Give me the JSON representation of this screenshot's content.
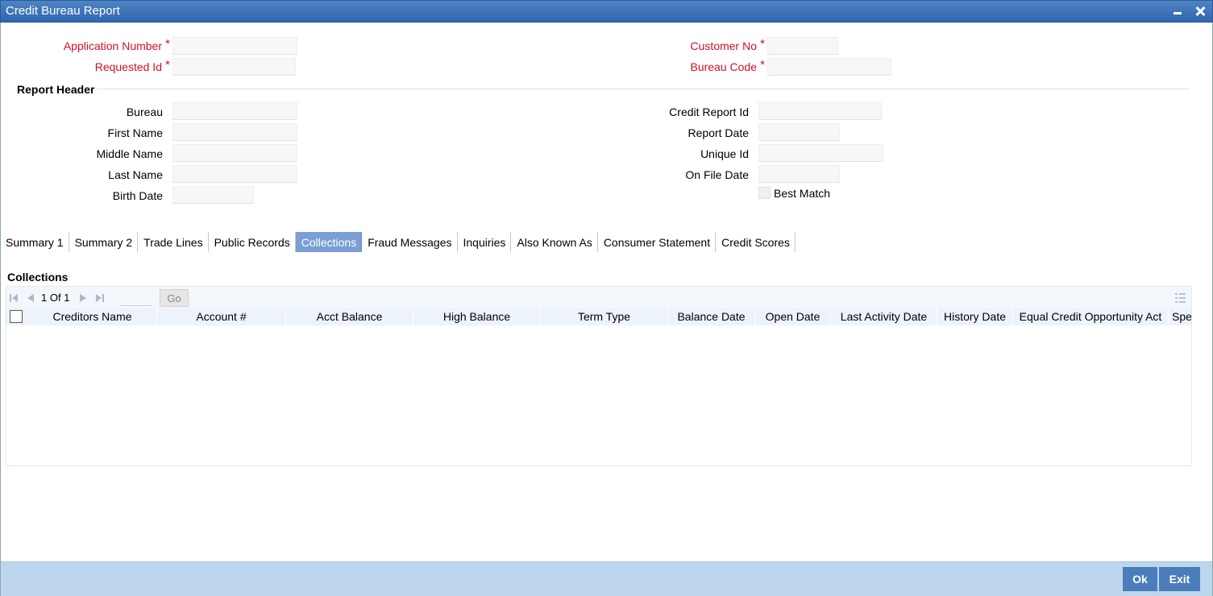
{
  "window": {
    "title": "Credit Bureau Report"
  },
  "top_fields": {
    "application_number": {
      "label": "Application Number",
      "value": ""
    },
    "requested_id": {
      "label": "Requested Id",
      "value": ""
    },
    "customer_no": {
      "label": "Customer No",
      "value": ""
    },
    "bureau_code": {
      "label": "Bureau Code",
      "value": ""
    },
    "required_mark": "*"
  },
  "report_header": {
    "title": "Report Header",
    "bureau": {
      "label": "Bureau",
      "value": ""
    },
    "first_name": {
      "label": "First Name",
      "value": ""
    },
    "middle_name": {
      "label": "Middle Name",
      "value": ""
    },
    "last_name": {
      "label": "Last Name",
      "value": ""
    },
    "birth_date": {
      "label": "Birth Date",
      "value": ""
    },
    "credit_report_id": {
      "label": "Credit Report Id",
      "value": ""
    },
    "report_date": {
      "label": "Report Date",
      "value": ""
    },
    "unique_id": {
      "label": "Unique Id",
      "value": ""
    },
    "on_file_date": {
      "label": "On File Date",
      "value": ""
    },
    "best_match": {
      "label": "Best Match",
      "checked": false
    }
  },
  "tabs": [
    {
      "label": "Summary 1",
      "active": false
    },
    {
      "label": "Summary 2",
      "active": false
    },
    {
      "label": "Trade Lines",
      "active": false
    },
    {
      "label": "Public Records",
      "active": false
    },
    {
      "label": "Collections",
      "active": true
    },
    {
      "label": "Fraud Messages",
      "active": false
    },
    {
      "label": "Inquiries",
      "active": false
    },
    {
      "label": "Also Known As",
      "active": false
    },
    {
      "label": "Consumer Statement",
      "active": false
    },
    {
      "label": "Credit Scores",
      "active": false
    }
  ],
  "collections": {
    "title": "Collections",
    "pager": {
      "current": "1",
      "of_label": "Of",
      "total": "1",
      "go_label": "Go"
    },
    "columns": [
      "Creditors Name",
      "Account #",
      "Acct Balance",
      "High Balance",
      "Term Type",
      "Balance Date",
      "Open Date",
      "Last Activity Date",
      "History Date",
      "Equal Credit Opportunity Act",
      "Spec"
    ],
    "rows": []
  },
  "footer": {
    "ok_label": "Ok",
    "exit_label": "Exit"
  },
  "colors": {
    "titlebar": "#3a70b5",
    "required": "#d0102a",
    "active_tab": "#7b9fd4",
    "footer": "#bdd6ee",
    "button": "#4b7dba"
  }
}
